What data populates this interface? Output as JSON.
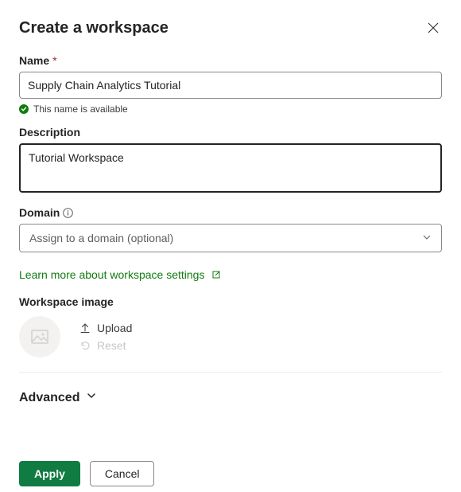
{
  "title": "Create a workspace",
  "name": {
    "label": "Name",
    "value": "Supply Chain Analytics Tutorial",
    "availability": "This name is available"
  },
  "description": {
    "label": "Description",
    "value": "Tutorial Workspace"
  },
  "domain": {
    "label": "Domain",
    "placeholder": "Assign to a domain (optional)"
  },
  "learn_more": "Learn more about workspace settings",
  "image": {
    "label": "Workspace image",
    "upload": "Upload",
    "reset": "Reset"
  },
  "advanced": "Advanced",
  "buttons": {
    "apply": "Apply",
    "cancel": "Cancel"
  }
}
